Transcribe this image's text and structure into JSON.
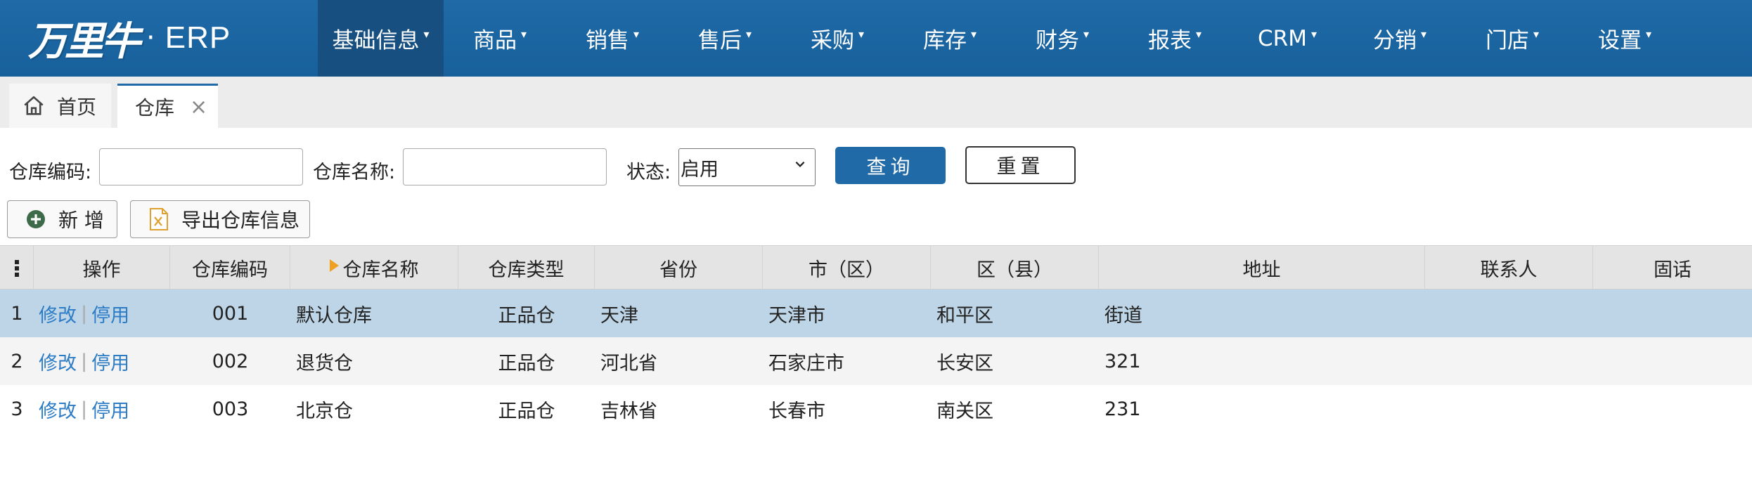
{
  "brand": {
    "logo_text": "万里牛",
    "dot": "·",
    "product": "ERP"
  },
  "nav": [
    {
      "label": "基础信息",
      "active": true
    },
    {
      "label": "商品"
    },
    {
      "label": "销售"
    },
    {
      "label": "售后"
    },
    {
      "label": "采购"
    },
    {
      "label": "库存"
    },
    {
      "label": "财务"
    },
    {
      "label": "报表"
    },
    {
      "label": "CRM"
    },
    {
      "label": "分销"
    },
    {
      "label": "门店"
    },
    {
      "label": "设置"
    }
  ],
  "tabs": {
    "home": "首页",
    "current": "仓库",
    "close": "×"
  },
  "form": {
    "code_label": "仓库编码:",
    "code_value": "",
    "name_label": "仓库名称:",
    "name_value": "",
    "status_label": "状态:",
    "status_value": "启用",
    "query": "查询",
    "reset": "重置"
  },
  "toolbar": {
    "add": "新 增",
    "export": "导出仓库信息"
  },
  "table": {
    "columns": [
      "操作",
      "仓库编码",
      "仓库名称",
      "仓库类型",
      "省份",
      "市（区）",
      "区（县）",
      "地址",
      "联系人",
      "固话"
    ],
    "edit": "修改",
    "disable": "停用",
    "divider": "|",
    "rows": [
      {
        "n": "1",
        "code": "001",
        "name": "默认仓库",
        "type": "正品仓",
        "province": "天津",
        "city": "天津市",
        "district": "和平区",
        "address": "街道",
        "contact": "",
        "phone": ""
      },
      {
        "n": "2",
        "code": "002",
        "name": "退货仓",
        "type": "正品仓",
        "province": "河北省",
        "city": "石家庄市",
        "district": "长安区",
        "address": "321",
        "contact": "",
        "phone": ""
      },
      {
        "n": "3",
        "code": "003",
        "name": "北京仓",
        "type": "正品仓",
        "province": "吉林省",
        "city": "长春市",
        "district": "南关区",
        "address": "231",
        "contact": "",
        "phone": ""
      }
    ]
  },
  "colors": {
    "brand_blue": "#1f6aa7",
    "nav_active": "#164f80",
    "selected_row": "#bdd5e6",
    "link": "#2d7cc6"
  }
}
